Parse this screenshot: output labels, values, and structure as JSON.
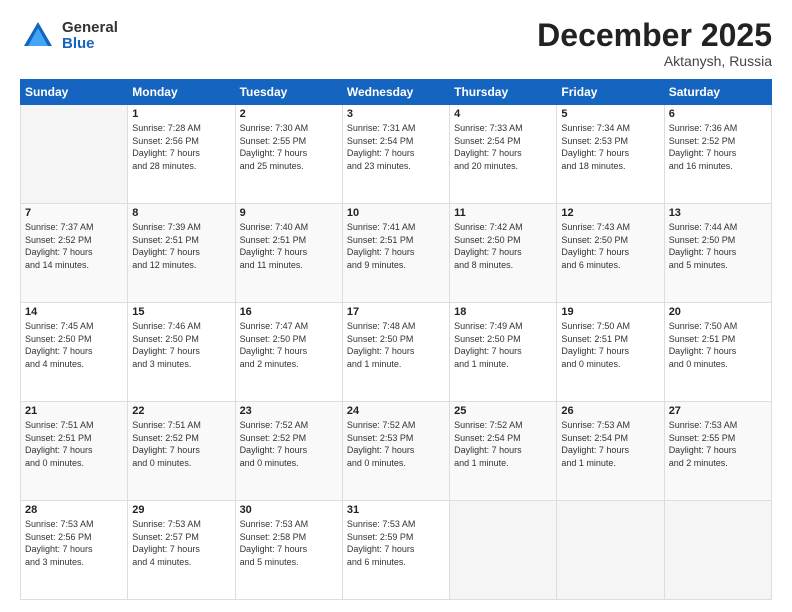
{
  "logo": {
    "general": "General",
    "blue": "Blue"
  },
  "header": {
    "month_year": "December 2025",
    "location": "Aktanysh, Russia"
  },
  "weekdays": [
    "Sunday",
    "Monday",
    "Tuesday",
    "Wednesday",
    "Thursday",
    "Friday",
    "Saturday"
  ],
  "weeks": [
    [
      {
        "day": "",
        "info": ""
      },
      {
        "day": "1",
        "info": "Sunrise: 7:28 AM\nSunset: 2:56 PM\nDaylight: 7 hours\nand 28 minutes."
      },
      {
        "day": "2",
        "info": "Sunrise: 7:30 AM\nSunset: 2:55 PM\nDaylight: 7 hours\nand 25 minutes."
      },
      {
        "day": "3",
        "info": "Sunrise: 7:31 AM\nSunset: 2:54 PM\nDaylight: 7 hours\nand 23 minutes."
      },
      {
        "day": "4",
        "info": "Sunrise: 7:33 AM\nSunset: 2:54 PM\nDaylight: 7 hours\nand 20 minutes."
      },
      {
        "day": "5",
        "info": "Sunrise: 7:34 AM\nSunset: 2:53 PM\nDaylight: 7 hours\nand 18 minutes."
      },
      {
        "day": "6",
        "info": "Sunrise: 7:36 AM\nSunset: 2:52 PM\nDaylight: 7 hours\nand 16 minutes."
      }
    ],
    [
      {
        "day": "7",
        "info": "Sunrise: 7:37 AM\nSunset: 2:52 PM\nDaylight: 7 hours\nand 14 minutes."
      },
      {
        "day": "8",
        "info": "Sunrise: 7:39 AM\nSunset: 2:51 PM\nDaylight: 7 hours\nand 12 minutes."
      },
      {
        "day": "9",
        "info": "Sunrise: 7:40 AM\nSunset: 2:51 PM\nDaylight: 7 hours\nand 11 minutes."
      },
      {
        "day": "10",
        "info": "Sunrise: 7:41 AM\nSunset: 2:51 PM\nDaylight: 7 hours\nand 9 minutes."
      },
      {
        "day": "11",
        "info": "Sunrise: 7:42 AM\nSunset: 2:50 PM\nDaylight: 7 hours\nand 8 minutes."
      },
      {
        "day": "12",
        "info": "Sunrise: 7:43 AM\nSunset: 2:50 PM\nDaylight: 7 hours\nand 6 minutes."
      },
      {
        "day": "13",
        "info": "Sunrise: 7:44 AM\nSunset: 2:50 PM\nDaylight: 7 hours\nand 5 minutes."
      }
    ],
    [
      {
        "day": "14",
        "info": "Sunrise: 7:45 AM\nSunset: 2:50 PM\nDaylight: 7 hours\nand 4 minutes."
      },
      {
        "day": "15",
        "info": "Sunrise: 7:46 AM\nSunset: 2:50 PM\nDaylight: 7 hours\nand 3 minutes."
      },
      {
        "day": "16",
        "info": "Sunrise: 7:47 AM\nSunset: 2:50 PM\nDaylight: 7 hours\nand 2 minutes."
      },
      {
        "day": "17",
        "info": "Sunrise: 7:48 AM\nSunset: 2:50 PM\nDaylight: 7 hours\nand 1 minute."
      },
      {
        "day": "18",
        "info": "Sunrise: 7:49 AM\nSunset: 2:50 PM\nDaylight: 7 hours\nand 1 minute."
      },
      {
        "day": "19",
        "info": "Sunrise: 7:50 AM\nSunset: 2:51 PM\nDaylight: 7 hours\nand 0 minutes."
      },
      {
        "day": "20",
        "info": "Sunrise: 7:50 AM\nSunset: 2:51 PM\nDaylight: 7 hours\nand 0 minutes."
      }
    ],
    [
      {
        "day": "21",
        "info": "Sunrise: 7:51 AM\nSunset: 2:51 PM\nDaylight: 7 hours\nand 0 minutes."
      },
      {
        "day": "22",
        "info": "Sunrise: 7:51 AM\nSunset: 2:52 PM\nDaylight: 7 hours\nand 0 minutes."
      },
      {
        "day": "23",
        "info": "Sunrise: 7:52 AM\nSunset: 2:52 PM\nDaylight: 7 hours\nand 0 minutes."
      },
      {
        "day": "24",
        "info": "Sunrise: 7:52 AM\nSunset: 2:53 PM\nDaylight: 7 hours\nand 0 minutes."
      },
      {
        "day": "25",
        "info": "Sunrise: 7:52 AM\nSunset: 2:54 PM\nDaylight: 7 hours\nand 1 minute."
      },
      {
        "day": "26",
        "info": "Sunrise: 7:53 AM\nSunset: 2:54 PM\nDaylight: 7 hours\nand 1 minute."
      },
      {
        "day": "27",
        "info": "Sunrise: 7:53 AM\nSunset: 2:55 PM\nDaylight: 7 hours\nand 2 minutes."
      }
    ],
    [
      {
        "day": "28",
        "info": "Sunrise: 7:53 AM\nSunset: 2:56 PM\nDaylight: 7 hours\nand 3 minutes."
      },
      {
        "day": "29",
        "info": "Sunrise: 7:53 AM\nSunset: 2:57 PM\nDaylight: 7 hours\nand 4 minutes."
      },
      {
        "day": "30",
        "info": "Sunrise: 7:53 AM\nSunset: 2:58 PM\nDaylight: 7 hours\nand 5 minutes."
      },
      {
        "day": "31",
        "info": "Sunrise: 7:53 AM\nSunset: 2:59 PM\nDaylight: 7 hours\nand 6 minutes."
      },
      {
        "day": "",
        "info": ""
      },
      {
        "day": "",
        "info": ""
      },
      {
        "day": "",
        "info": ""
      }
    ]
  ]
}
